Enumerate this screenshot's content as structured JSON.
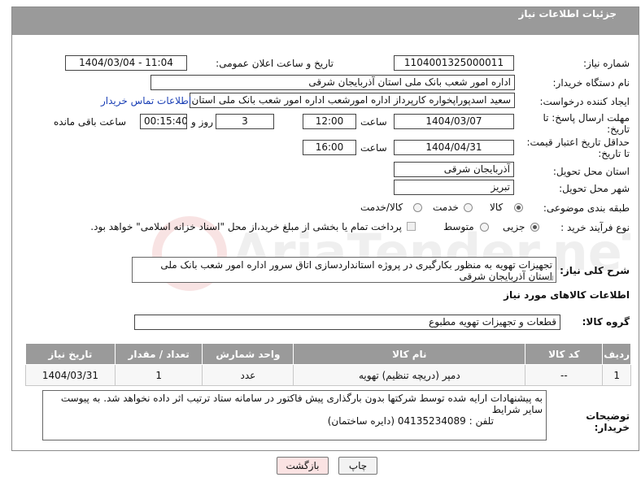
{
  "header": {
    "title": "جزئیات اطلاعات نیاز"
  },
  "form": {
    "need_number_label": "شماره نیاز:",
    "need_number": "1104001325000011",
    "announce_label": "تاریخ و ساعت اعلان عمومی:",
    "announce_value": "1404/03/04 - 11:04",
    "buyer_org_label": "نام دستگاه خریدار:",
    "buyer_org": "اداره امور شعب بانک ملی استان آذربایجان شرقی",
    "creator_label": "ایجاد کننده درخواست:",
    "creator": "سعید اسدپوراپخواره کارپرداز اداره امورشعب  اداره امور شعب بانک ملی استان آذ",
    "contact_link": "اطلاعات تماس خریدار",
    "deadline_label_1": "مهلت ارسال پاسخ: تا",
    "deadline_label_2": "تاریخ:",
    "deadline_date": "1404/03/07",
    "time_word": "ساعت",
    "deadline_time": "12:00",
    "days_value": "3",
    "days_word": "روز و",
    "remaining_time": "00:15:40",
    "remaining_label": "ساعت باقی مانده",
    "validity_label_1": "حداقل تاریخ اعتبار قیمت:",
    "validity_label_2": "تا تاریخ:",
    "validity_date": "1404/04/31",
    "validity_time": "16:00",
    "province_label": "استان محل تحویل:",
    "province": "آذربایجان شرقی",
    "city_label": "شهر محل تحویل:",
    "city": "تبریز",
    "category_label": "طبقه بندی موضوعی:",
    "category_options": [
      "کالا",
      "خدمت",
      "کالا/خدمت"
    ],
    "process_label": "نوع فرآیند خرید :",
    "process_options": [
      "جزیی",
      "متوسط"
    ],
    "payment_note": "پرداخت تمام یا بخشی از مبلغ خرید،از محل \"اسناد خزانه اسلامی\" خواهد بود."
  },
  "description": {
    "label": "شرح کلی نیاز:",
    "text": "تجهیزات تهویه به منظور بکارگیری در پروژه استانداردسازی اتاق سرور اداره امور شعب بانک ملی استان آذربایجان شرقی"
  },
  "goods_info": {
    "title": "اطلاعات کالاهای مورد نیاز",
    "group_label": "گروه کالا:",
    "group_value": "قطعات و تجهیزات تهویه مطبوع"
  },
  "table": {
    "headers": [
      "ردیف",
      "کد کالا",
      "نام کالا",
      "واحد شمارش",
      "تعداد / مقدار",
      "تاریخ نیاز"
    ],
    "rows": [
      [
        "1",
        "--",
        "دمپر (دریچه تنظیم) تهویه",
        "عدد",
        "1",
        "1404/03/31"
      ]
    ]
  },
  "buyer_notes": {
    "label": "توضیحات خریدار:",
    "line1": "به پیشنهادات ارایه شده توسط شرکتها بدون بارگذاری پیش فاکتور در سامانه ستاد ترتیب اثر داده نخواهد شد. به پیوست سایر شرایط",
    "line2": "تلفن : 04135234089 (دایره ساختمان)"
  },
  "buttons": {
    "print": "چاپ",
    "back": "بازگشت"
  },
  "watermark_text": "AriaTender.neT",
  "colors": {
    "header_bg": "#9a9a9a",
    "back_button_bg": "#fbe3e3",
    "link": "#1a3fb5"
  }
}
